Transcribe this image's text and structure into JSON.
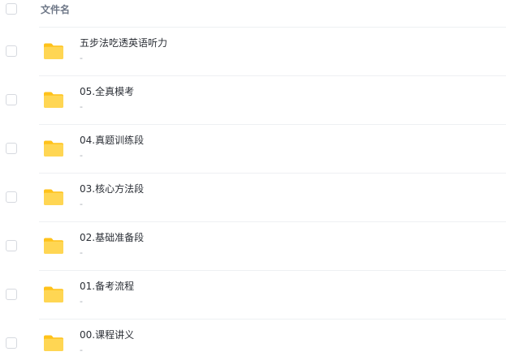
{
  "header": {
    "column_name": "文件名"
  },
  "files": [
    {
      "name": "五步法吃透英语听力",
      "detail": "-"
    },
    {
      "name": "05.全真模考",
      "detail": "-"
    },
    {
      "name": "04.真题训练段",
      "detail": "-"
    },
    {
      "name": "03.核心方法段",
      "detail": "-"
    },
    {
      "name": "02.基础准备段",
      "detail": "-"
    },
    {
      "name": "01.备考流程",
      "detail": "-"
    },
    {
      "name": "00.课程讲义",
      "detail": "-"
    }
  ],
  "icons": {
    "row_icon": "folder-icon",
    "folder_colors": [
      "#FFC21A",
      "#FFD653"
    ]
  }
}
